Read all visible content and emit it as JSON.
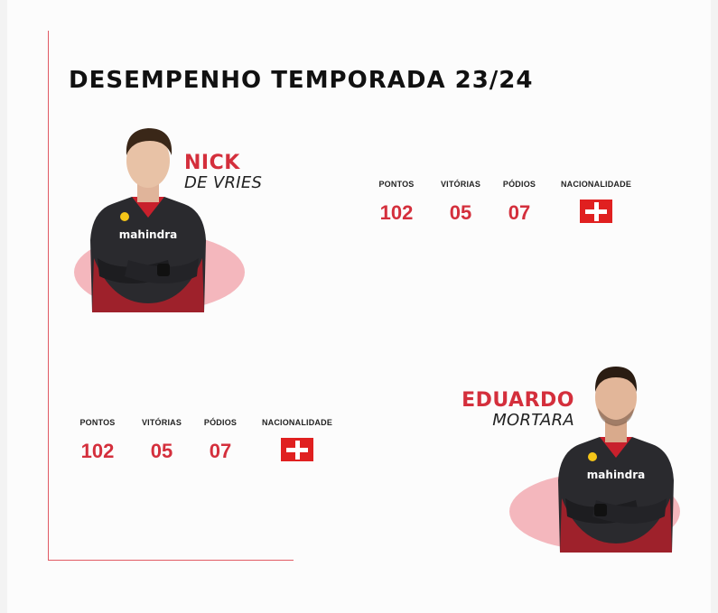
{
  "page": {
    "title": "DESEMPENHO TEMPORADA 23/24"
  },
  "colors": {
    "accent": "#d42f3c",
    "blob": "#f4b7bd",
    "suit": "#2a2a2e",
    "flag": "#e02020"
  },
  "drivers": [
    {
      "first_name": "NICK",
      "last_name": "DE VRIES",
      "sponsor_text": "mahindra",
      "stats": {
        "pontos_label": "PONTOS",
        "pontos": "102",
        "vitorias_label": "VITÓRIAS",
        "vitorias": "05",
        "podios_label": "PÓDIOS",
        "podios": "07",
        "nacionalidade_label": "NACIONALIDADE",
        "flag_icon": "swiss-flag-icon"
      }
    },
    {
      "first_name": "EDUARDO",
      "last_name": "MORTARA",
      "sponsor_text": "mahindra",
      "stats": {
        "pontos_label": "PONTOS",
        "pontos": "102",
        "vitorias_label": "VITÓRIAS",
        "vitorias": "05",
        "podios_label": "PÓDIOS",
        "podios": "07",
        "nacionalidade_label": "NACIONALIDADE",
        "flag_icon": "swiss-flag-icon"
      }
    }
  ]
}
